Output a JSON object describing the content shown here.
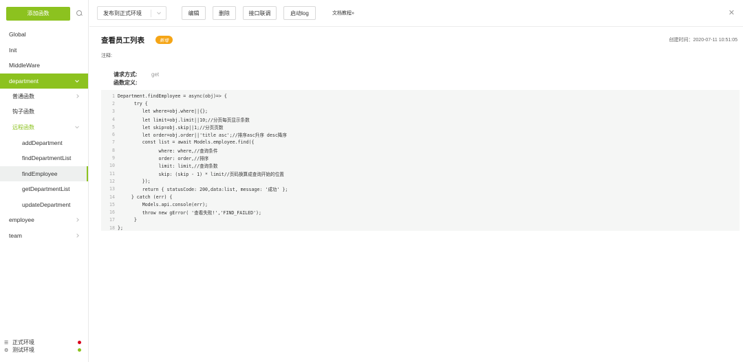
{
  "sidebar": {
    "add_button": "添加函数",
    "menu": [
      {
        "label": "Global",
        "level": 1
      },
      {
        "label": "Init",
        "level": 1
      },
      {
        "label": "MiddleWare",
        "level": 1
      },
      {
        "label": "department",
        "level": 1
      },
      {
        "label": "普通函数",
        "level": 2
      },
      {
        "label": "钩子函数",
        "level": 2
      },
      {
        "label": "远程函数",
        "level": 2
      },
      {
        "label": "addDepartment",
        "level": 3
      },
      {
        "label": "findDepartmentList",
        "level": 3
      },
      {
        "label": "findEmployee",
        "level": 3
      },
      {
        "label": "getDepartmentList",
        "level": 3
      },
      {
        "label": "updateDepartment",
        "level": 3
      },
      {
        "label": "employee",
        "level": 1
      },
      {
        "label": "team",
        "level": 1
      }
    ],
    "environments": [
      {
        "label": "正式环境",
        "color": "#d9001b"
      },
      {
        "label": "测试环境",
        "color": "#8cc21f"
      }
    ]
  },
  "toolbar": {
    "env_select": "发布到正式环境",
    "edit": "编辑",
    "delete": "删除",
    "api_debug": "接口联调",
    "start_log": "启动log",
    "docs": "文档教程»"
  },
  "main": {
    "title": "查看员工列表",
    "badge": "新增",
    "created": "创建时间：2020-07-11 10:51:05",
    "note": "注释:",
    "request_method_label": "请求方式:",
    "request_method_value": "get",
    "function_def_label": "函数定义:"
  },
  "code": [
    "Department.findEmployee = async(obj)=> {",
    "      try {",
    "         let where=obj.where||{};",
    "         let limit=obj.limit||10;//分页每页显示条数",
    "         let skip=obj.skip||1;//分页页数",
    "         let order=obj.order||'title asc';//排序asc升序 desc降序",
    "         const list = await Models.employee.find({",
    "               where: where,//查询条件",
    "               order: order,//排序",
    "               limit: limit,//查询条数",
    "               skip: (skip - 1) * limit//页码换算成查询开始的位置",
    "         });",
    "         return { statusCode: 200,data:list, message: '成功' };",
    "     } catch (err) {",
    "         Models.api.console(err);",
    "         throw new gError( '查看失败!','FIND_FAILED');",
    "      }",
    "};"
  ]
}
